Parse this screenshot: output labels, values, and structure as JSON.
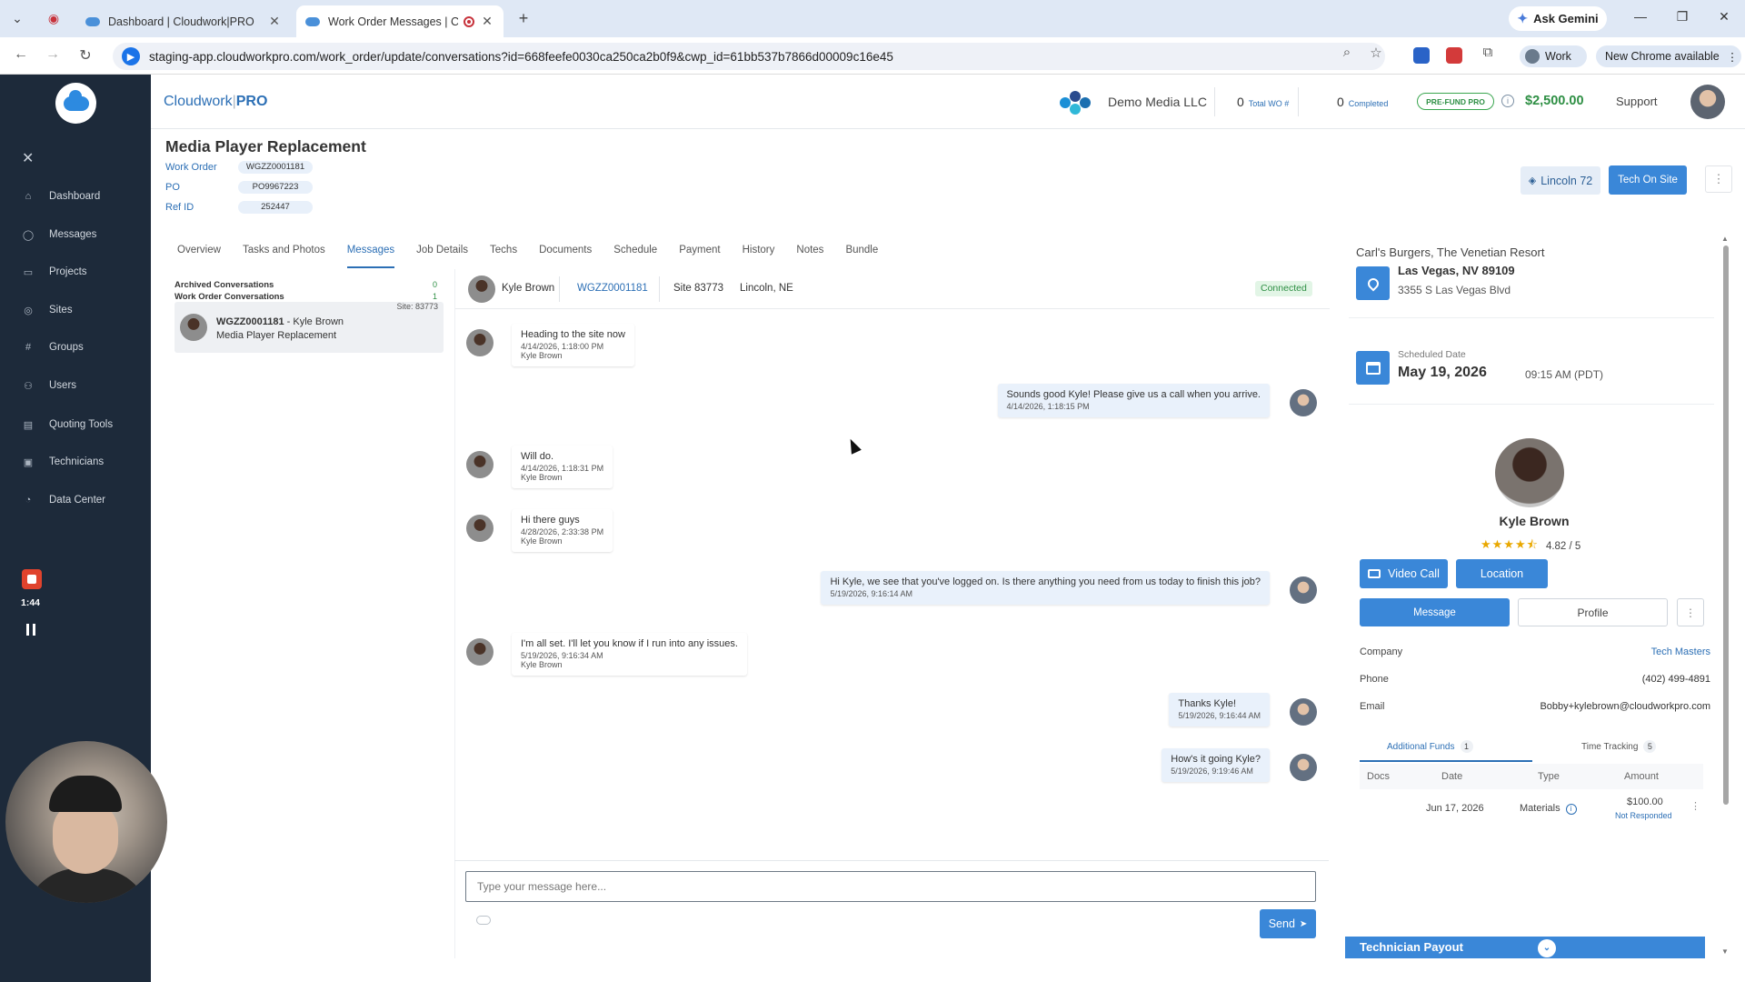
{
  "browser": {
    "tabs": [
      {
        "title": "Dashboard | Cloudwork|PRO",
        "active": false
      },
      {
        "title": "Work Order Messages | Clo",
        "active": true
      }
    ],
    "new_tab": "+",
    "url": "staging-app.cloudworkpro.com/work_order/update/conversations?id=668feefe0030ca250ca2b0f9&cwp_id=61bb537b7866d00009c16e45",
    "ask_gemini": "Ask Gemini",
    "profile": "Work",
    "chrome_update": "New Chrome available"
  },
  "app": {
    "brand_prefix": "Cloudwork",
    "brand_suffix": "PRO",
    "company_name": "Demo Media LLC",
    "total_wo_count": "0",
    "total_wo_label": "Total WO #",
    "completed_count": "0",
    "completed_label": "Completed",
    "prefund_badge": "PRE-FUND PRO",
    "balance": "$2,500.00",
    "support": "Support"
  },
  "sidebar": {
    "items": [
      {
        "label": "Dashboard",
        "icon": "home-icon"
      },
      {
        "label": "Messages",
        "icon": "chat-icon"
      },
      {
        "label": "Projects",
        "icon": "folder-icon"
      },
      {
        "label": "Sites",
        "icon": "pin-icon"
      },
      {
        "label": "Groups",
        "icon": "hash-icon"
      },
      {
        "label": "Users",
        "icon": "users-icon"
      },
      {
        "label": "Quoting Tools",
        "icon": "document-icon"
      },
      {
        "label": "Technicians",
        "icon": "id-card-icon"
      },
      {
        "label": "Data Center",
        "icon": "gauge-icon"
      }
    ],
    "recording_time": "1:44"
  },
  "work_order": {
    "title": "Media Player Replacement",
    "fields": [
      {
        "label": "Work Order",
        "value": "WGZZ0001181"
      },
      {
        "label": "PO",
        "value": "PO9967223"
      },
      {
        "label": "Ref ID",
        "value": "252447"
      }
    ],
    "lincoln_button": "Lincoln 72",
    "tech_on_site_button": "Tech On Site"
  },
  "tabs": [
    {
      "label": "Overview",
      "active": false
    },
    {
      "label": "Tasks and Photos",
      "active": false
    },
    {
      "label": "Messages",
      "active": true
    },
    {
      "label": "Job Details",
      "active": false
    },
    {
      "label": "Techs",
      "active": false
    },
    {
      "label": "Documents",
      "active": false
    },
    {
      "label": "Schedule",
      "active": false
    },
    {
      "label": "Payment",
      "active": false
    },
    {
      "label": "History",
      "active": false
    },
    {
      "label": "Notes",
      "active": false
    },
    {
      "label": "Bundle",
      "active": false
    }
  ],
  "conversations": {
    "archived_label": "Archived Conversations",
    "archived_count": "0",
    "work_order_label": "Work Order Conversations",
    "work_order_count": "1",
    "item": {
      "site": "Site: 83773",
      "wo": "WGZZ0001181",
      "sep": " - ",
      "name": "Kyle Brown",
      "subtitle": "Media Player Replacement"
    }
  },
  "thread": {
    "header": {
      "name": "Kyle Brown",
      "wo_link": "WGZZ0001181",
      "site": "Site 83773",
      "city": "Lincoln, NE",
      "status": "Connected"
    },
    "messages": [
      {
        "dir": "in",
        "body": "Heading to the site now",
        "time": "4/14/2026, 1:18:00 PM",
        "author": "Kyle Brown"
      },
      {
        "dir": "out",
        "body": "Sounds good Kyle!  Please give us a call when you arrive.",
        "time": "4/14/2026, 1:18:15 PM"
      },
      {
        "dir": "in",
        "body": "Will do.",
        "time": "4/14/2026, 1:18:31 PM",
        "author": "Kyle Brown"
      },
      {
        "dir": "in",
        "body": "Hi there guys",
        "time": "4/28/2026, 2:33:38 PM",
        "author": "Kyle Brown"
      },
      {
        "dir": "out",
        "body": "Hi Kyle, we see that you've logged on.  Is there anything you need from us today to finish this job?",
        "time": "5/19/2026, 9:16:14 AM"
      },
      {
        "dir": "in",
        "body": "I'm all set. I'll let you know if I run into any issues.",
        "time": "5/19/2026, 9:16:34 AM",
        "author": "Kyle Brown"
      },
      {
        "dir": "out",
        "body": "Thanks Kyle!",
        "time": "5/19/2026, 9:16:44 AM"
      },
      {
        "dir": "out",
        "body": "How's it going Kyle?",
        "time": "5/19/2026, 9:19:46 AM"
      }
    ],
    "composer_placeholder": "Type your message here...",
    "send_label": "Send"
  },
  "details": {
    "location_name": "Carl's Burgers, The Venetian Resort",
    "city_line": "Las Vegas, NV 89109",
    "street": "3355 S Las Vegas Blvd",
    "scheduled_label": "Scheduled Date",
    "scheduled_date": "May 19, 2026",
    "scheduled_time": "09:15 AM (PDT)",
    "tech_name": "Kyle Brown",
    "rating": 4.5,
    "rating_text": "4.82 / 5",
    "video_call": "Video Call",
    "location_button": "Location",
    "message_button": "Message",
    "profile_button": "Profile",
    "company_label": "Company",
    "company_value": "Tech Masters",
    "phone_label": "Phone",
    "phone_value": "(402) 499-4891",
    "email_label": "Email",
    "email_value": "Bobby+kylebrown@cloudworkpro.com",
    "subtab_funds": "Additional Funds",
    "subtab_funds_count": "1",
    "subtab_time": "Time Tracking",
    "subtab_time_count": "5",
    "fund_columns": [
      "Docs",
      "Date",
      "Type",
      "Amount"
    ],
    "fund_row": {
      "date": "Jun 17, 2026",
      "type": "Materials",
      "amount": "$100.00",
      "status": "Not Responded"
    },
    "payout": "Technician Payout"
  },
  "colors": {
    "accent": "#3a87d8",
    "sidebar": "#1d2a3a",
    "success": "#2e8f44"
  }
}
